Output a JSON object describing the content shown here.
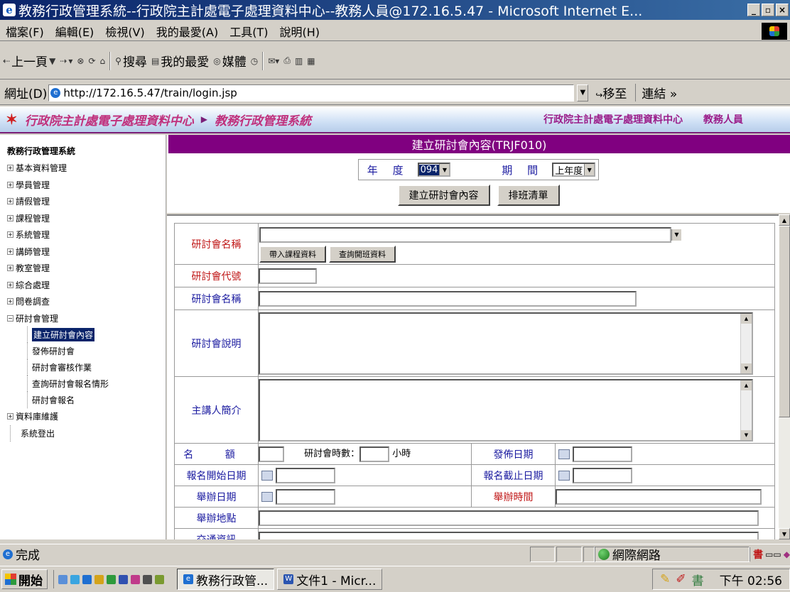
{
  "window": {
    "title": "教務行政管理系統--行政院主計處電子處理資料中心--教務人員@172.16.5.47 - Microsoft Internet E...",
    "min": "_",
    "max": "▫",
    "close": "×"
  },
  "menu": [
    "檔案(F)",
    "編輯(E)",
    "檢視(V)",
    "我的最愛(A)",
    "工具(T)",
    "說明(H)"
  ],
  "toolbar": {
    "back": "上一頁",
    "search": "搜尋",
    "favorites": "我的最愛",
    "media": "媒體"
  },
  "address": {
    "label": "網址(D)",
    "url": "http://172.16.5.47/train/login.jsp",
    "go": "移至",
    "links": "連結"
  },
  "banner": {
    "left": "行政院主計處電子處理資料中心",
    "arrow": "▶",
    "system": "教務行政管理系統",
    "right_org": "行政院主計處電子處理資料中心",
    "right_user": "教務人員"
  },
  "sidebar": {
    "root": "教務行政管理系統",
    "items": [
      "基本資料管理",
      "學員管理",
      "請假管理",
      "課程管理",
      "系統管理",
      "講師管理",
      "教室管理",
      "綜合處理",
      "問卷調查"
    ],
    "open": "研討會管理",
    "children": [
      "建立研討會內容",
      "發佈研討會",
      "研討會審核作業",
      "查詢研討會報名情形",
      "研討會報名"
    ],
    "after": [
      "資料庫維護"
    ],
    "leaf": "系統登出"
  },
  "page": {
    "title": "建立研討會內容(TRJF010)",
    "year_label": "年 度",
    "year_value": "094",
    "period_label": "期 間",
    "period_value": "上年度",
    "btn_create": "建立研討會內容",
    "btn_schedule": "排班清單"
  },
  "form": {
    "name_select": "研討會名稱",
    "btn_import": "帶入課程資料",
    "btn_query": "查詢開班資料",
    "code": "研討會代號",
    "name": "研討會名稱",
    "desc": "研討會說明",
    "speaker": "主講人簡介",
    "quota": "名 額",
    "hours": "研討會時數：",
    "hours_unit": "小時",
    "publish": "發佈日期",
    "reg_start": "報名開始日期",
    "reg_end": "報名截止日期",
    "hold_date": "舉辦日期",
    "hold_time": "舉辦時間",
    "place": "舉辦地點",
    "traffic": "交通資訊"
  },
  "status": {
    "text": "完成",
    "zone": "網際網路",
    "ime": "書"
  },
  "taskbar": {
    "start": "開始",
    "task1": "教務行政管...",
    "task2": "文件1 - Micr...",
    "time": "下午 02:56"
  }
}
